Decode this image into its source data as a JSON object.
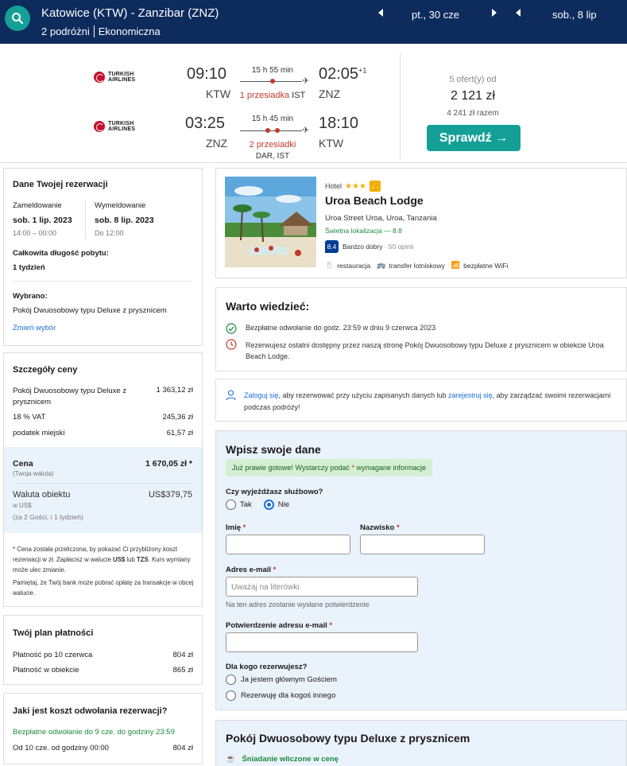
{
  "header": {
    "route": "Katowice (KTW) - Zanzibar (ZNZ)",
    "travellers": "2 podróżni",
    "cabin": "Ekonomiczna",
    "depart_date": "pt., 30 cze",
    "return_date": "sob., 8 lip"
  },
  "flights": {
    "outbound": {
      "airline_line1": "TURKISH",
      "airline_line2": "AIRLINES",
      "dep_time": "09:10",
      "dep_code": "KTW",
      "duration": "15 h 55 min",
      "stops": "1 przesiadka",
      "via": "IST",
      "arr_time": "02:05",
      "day_offset": "+1",
      "arr_code": "ZNZ"
    },
    "inbound": {
      "airline_line1": "TURKISH",
      "airline_line2": "AIRLINES",
      "dep_time": "03:25",
      "dep_code": "ZNZ",
      "duration": "15 h 45 min",
      "stops": "2 przesiadki",
      "via": "DAR, IST",
      "arr_time": "18:10",
      "arr_code": "KTW"
    },
    "offers": "5 ofert(y) od",
    "price": "2 121 zł",
    "total": "4 241 zł razem",
    "check_button": "Sprawdź →"
  },
  "booking": {
    "title": "Dane Twojej rezerwacji",
    "checkin_label": "Zameldowanie",
    "checkin_date": "sob. 1 lip. 2023",
    "checkin_time": "14:00 – 00:00",
    "checkout_label": "Wymeldowanie",
    "checkout_date": "sob. 8 lip. 2023",
    "checkout_time": "Do 12:00",
    "stay_label": "Całkowita długość pobytu:",
    "stay_value": "1 tydzień",
    "selected_label": "Wybrano:",
    "selected_value": "Pokój Dwuosobowy typu Deluxe z prysznicem",
    "change_link": "Zmień wybór"
  },
  "price_details": {
    "title": "Szczegóły ceny",
    "rows": [
      {
        "label": "Pokój Dwuosobowy typu Deluxe z prysznicem",
        "value": "1 363,12 zł"
      },
      {
        "label": "18 % VAT",
        "value": "245,36 zł"
      },
      {
        "label": "podatek miejski",
        "value": "61,57 zł"
      }
    ],
    "total_label": "Cena",
    "total_sub": "(Twoja waluta)",
    "total_value": "1 670,05 zł *",
    "local_label": "Waluta obiektu",
    "local_sub1": "w US$",
    "local_sub2": "(za 2 Gości, i 1 tydzień)",
    "local_value": "US$379,75",
    "note1_a": "* Cena została przeliczona, by pokazać Ci przybliżony koszt rezerwacji w zł. Zapłacisz w walucie ",
    "note1_b": "US$",
    "note1_c": " lub ",
    "note1_d": "TZS",
    "note1_e": ". Kurs wymiany może ulec zmianie.",
    "note2": "Pamiętaj, że Twój bank może pobrać opłatę za transakcje w obcej walucie."
  },
  "payment_plan": {
    "title": "Twój plan płatności",
    "rows": [
      {
        "label": "Płatność po 10 czerwca",
        "value": "804 zł"
      },
      {
        "label": "Płatność w obiekcie",
        "value": "865 zł"
      }
    ]
  },
  "cancellation": {
    "title": "Jaki jest koszt odwołania rezerwacji?",
    "free": "Bezpłatne odwołanie do 9 cze. do godziny 23:59",
    "paid_label": "Od 10 cze. od godziny 00:00",
    "paid_value": "804 zł"
  },
  "hotel": {
    "type": "Hotel",
    "stars": "★★★",
    "name": "Uroa Beach Lodge",
    "address": "Uroa Street Uroa, Uroa, Tanzania",
    "location": "Świetna lokalizacja — 8.8",
    "score": "8.4",
    "score_text": "Bardzo dobry",
    "reviews": "· 50 opinii",
    "amenity1": "restauracja",
    "amenity2": "transfer lotniskowy",
    "amenity3": "bezpłatne WiFi"
  },
  "good_to_know": {
    "title": "Warto wiedzieć:",
    "item1": "Bezpłatne odwołanie do godz. 23:59 w dniu 9 czerwca 2023",
    "item2": "Rezerwujesz ostatni dostępny przez naszą stronę Pokój Dwuosobowy typu Deluxe z prysznicem w obiekcie Uroa Beach Lodge."
  },
  "login": {
    "login_link": "Zaloguj się",
    "text1": ", aby rezerwować przy użyciu zapisanych danych lub ",
    "register_link": "zarejestruj się",
    "text2": ", aby zarządzać swoimi rezerwacjami podczas podróży!"
  },
  "form": {
    "title": "Wpisz swoje dane",
    "notice_a": "Już prawie gotowe! Wystarczy podać ",
    "notice_star": "*",
    "notice_b": " wymagane informacje",
    "business_label": "Czy wyjeżdżasz służbowo?",
    "yes": "Tak",
    "no": "Nie",
    "first_name": "Imię",
    "last_name": "Nazwisko",
    "email_label": "Adres e-mail",
    "email_placeholder": "Uważaj na literówki",
    "email_hint": "Na ten adres zostanie wysłane potwierdzenie",
    "confirm_label": "Potwierdzenie adresu e-mail",
    "for_whom": "Dla kogo rezerwujesz?",
    "opt1": "Ja jestem głównym Gościem",
    "opt2": "Rezerwuję dla kogoś innego",
    "star": "*"
  },
  "room": {
    "title": "Pokój Dwuosobowy typu Deluxe z prysznicem",
    "breakfast": "Śniadanie wliczone w cenę"
  }
}
